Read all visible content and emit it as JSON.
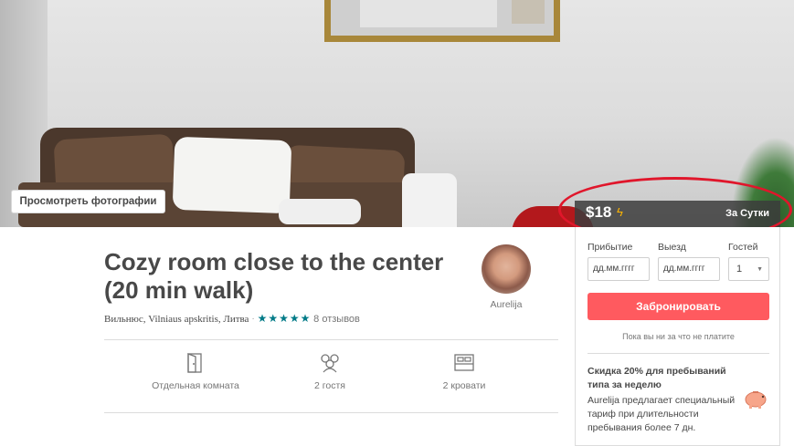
{
  "hero": {
    "view_photos_label": "Просмотреть фотографии"
  },
  "price": {
    "amount": "$18",
    "per": "За Сутки",
    "bolt_icon": "lightning-icon"
  },
  "listing": {
    "title": "Cozy room close to the center (20 min walk)",
    "location": "Вильнюс, Vilniaus apskritis, Литва",
    "stars": "★★★★★",
    "rating": 5,
    "reviews": "8 отзывов"
  },
  "host": {
    "name": "Aurelija"
  },
  "amenities": [
    {
      "icon": "door-icon",
      "label": "Отдельная комната"
    },
    {
      "icon": "guests-icon",
      "label": "2 гостя"
    },
    {
      "icon": "bed-icon",
      "label": "2 кровати"
    }
  ],
  "booking": {
    "checkin_label": "Прибытие",
    "checkout_label": "Выезд",
    "guests_label": "Гостей",
    "date_placeholder": "дд.мм.гггг",
    "guests_value": "1",
    "book_label": "Забронировать",
    "no_charge_note": "Пока вы ни за что не платите",
    "promo_title": "Скидка 20% для пребываний типа за неделю",
    "promo_text": "Aurelija предлагает специальный тариф при длительности пребывания более 7 дн."
  },
  "colors": {
    "brand": "#ff5a5f",
    "stars": "#007a87",
    "annotation": "#e0162b"
  }
}
